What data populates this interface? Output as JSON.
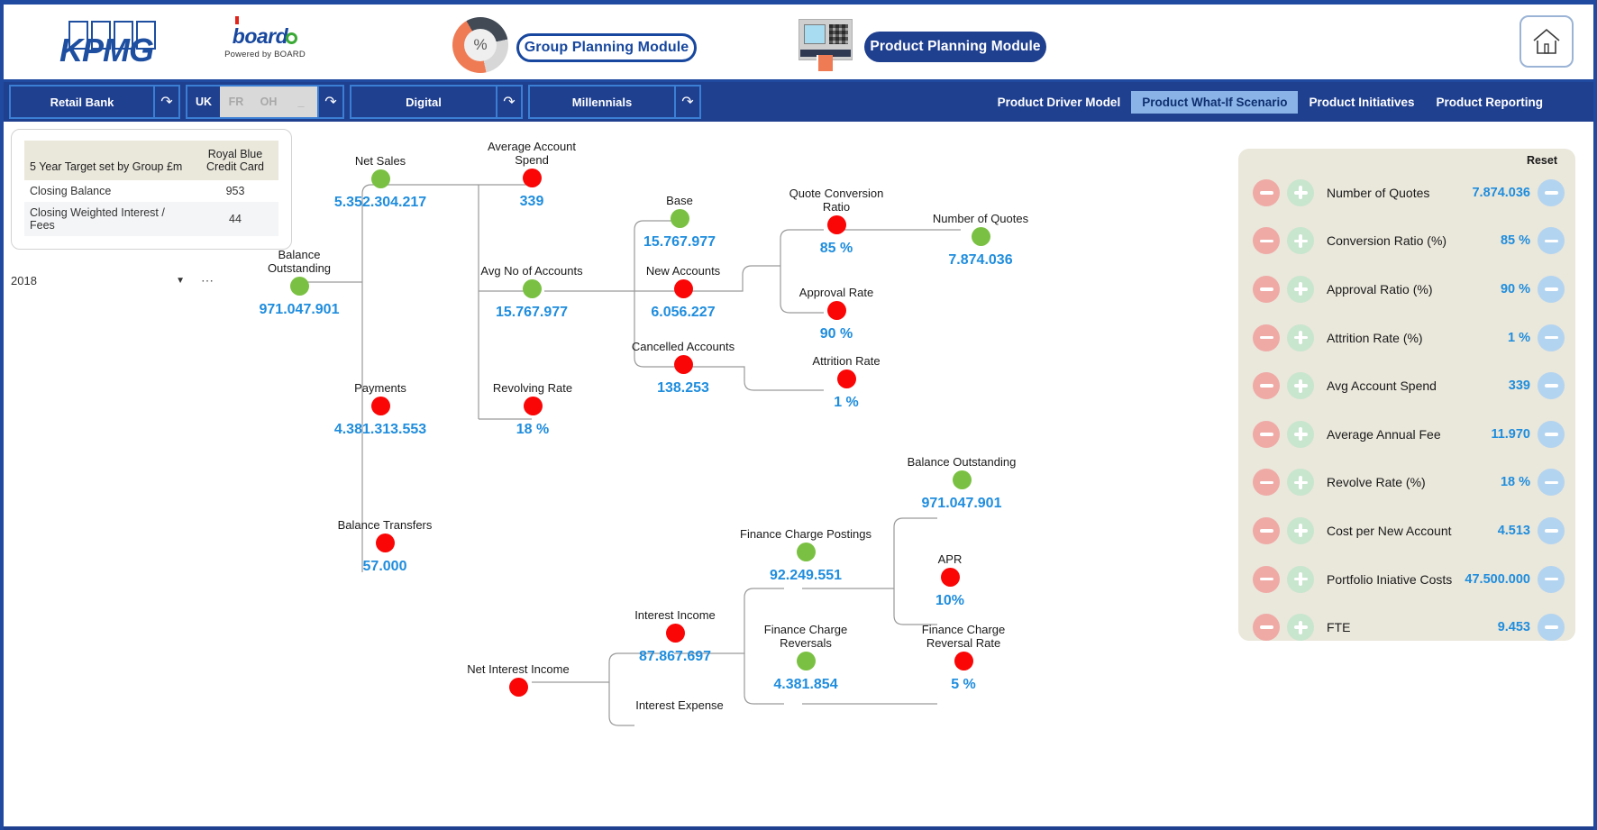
{
  "header": {
    "kpmg_logo_text": "KPMG",
    "board_logo_text": "board",
    "board_tagline": "Powered by BOARD",
    "donut_symbol": "%",
    "group_module_label": "Group Planning Module",
    "product_module_label": "Product  Planning Module",
    "home_icon": "home-icon"
  },
  "nav": {
    "entity": "Retail Bank",
    "countries": [
      "UK",
      "FR",
      "OH",
      "_"
    ],
    "channel": "Digital",
    "segment": "Millennials",
    "refresh_icon": "refresh-icon",
    "tabs": [
      {
        "label": "Product Driver Model",
        "active": false
      },
      {
        "label": "Product What-If Scenario",
        "active": true
      },
      {
        "label": "Product Initiatives",
        "active": false
      },
      {
        "label": "Product Reporting",
        "active": false
      }
    ]
  },
  "target_card": {
    "col_header_1": "5 Year Target set by Group £m",
    "col_header_2": "Royal Blue Credit Card",
    "rows": [
      {
        "label": "Closing Balance",
        "value": "953"
      },
      {
        "label": "Closing Weighted Interest / Fees",
        "value": "44"
      }
    ]
  },
  "year_selector": {
    "value": "2018",
    "caret_icon": "chevron-down-icon",
    "more_icon": "ellipsis-icon"
  },
  "chart_data": {
    "type": "diagram",
    "title": "Product What-If Scenario Driver Tree",
    "nodes": [
      {
        "id": "balance_outstanding",
        "label": "Balance Outstanding",
        "value": "971.047.901",
        "status": "green"
      },
      {
        "id": "net_sales",
        "label": "Net Sales",
        "value": "5.352.304.217",
        "status": "green"
      },
      {
        "id": "average_account_spend",
        "label": "Average Account Spend",
        "value": "339",
        "status": "red"
      },
      {
        "id": "avg_no_of_accounts",
        "label": "Avg No of Accounts",
        "value": "15.767.977",
        "status": "green"
      },
      {
        "id": "base",
        "label": "Base",
        "value": "15.767.977",
        "status": "green"
      },
      {
        "id": "new_accounts",
        "label": "New Accounts",
        "value": "6.056.227",
        "status": "red"
      },
      {
        "id": "cancelled_accounts",
        "label": "Cancelled Accounts",
        "value": "138.253",
        "status": "red"
      },
      {
        "id": "quote_conversion_ratio",
        "label": "Quote Conversion Ratio",
        "value": "85  %",
        "status": "red"
      },
      {
        "id": "approval_rate",
        "label": "Approval Rate",
        "value": "90 %",
        "status": "red"
      },
      {
        "id": "number_of_quotes",
        "label": "Number of Quotes",
        "value": "7.874.036",
        "status": "green"
      },
      {
        "id": "attrition_rate",
        "label": "Attrition Rate",
        "value": "1  %",
        "status": "red"
      },
      {
        "id": "payments",
        "label": "Payments",
        "value": "4.381.313.553",
        "status": "red"
      },
      {
        "id": "revolving_rate",
        "label": "Revolving Rate",
        "value": "18 %",
        "status": "red"
      },
      {
        "id": "balance_transfers",
        "label": "Balance Transfers",
        "value": "57.000",
        "status": "red"
      },
      {
        "id": "net_interest_income",
        "label": "Net Interest Income",
        "value": "",
        "status": "red"
      },
      {
        "id": "interest_income",
        "label": "Interest Income",
        "value": "87.867.697",
        "status": "red"
      },
      {
        "id": "interest_expense",
        "label": "Interest Expense",
        "value": "",
        "status": "none"
      },
      {
        "id": "finance_charge_postings",
        "label": "Finance Charge Postings",
        "value": "92.249.551",
        "status": "green"
      },
      {
        "id": "finance_charge_reversals",
        "label": "Finance Charge Reversals",
        "value": "4.381.854",
        "status": "green"
      },
      {
        "id": "balance_outstanding_2",
        "label": "Balance Outstanding",
        "value": "971.047.901",
        "status": "green"
      },
      {
        "id": "apr",
        "label": "APR",
        "value": "10%",
        "status": "red"
      },
      {
        "id": "fc_reversal_rate",
        "label": "Finance Charge Reversal Rate",
        "value": "5 %",
        "status": "red"
      }
    ]
  },
  "control_panel": {
    "reset_label": "Reset",
    "minus_icon": "minus-circle-icon",
    "plus_icon": "plus-circle-icon",
    "reset_icon": "reset-circle-icon",
    "rows": [
      {
        "label": "Number of Quotes",
        "value": "7.874.036"
      },
      {
        "label": "Conversion Ratio (%)",
        "value": "85 %"
      },
      {
        "label": "Approval Ratio (%)",
        "value": "90 %"
      },
      {
        "label": "Attrition Rate (%)",
        "value": "1 %"
      },
      {
        "label": "Avg Account Spend",
        "value": "339"
      },
      {
        "label": "Average Annual Fee",
        "value": "11.970"
      },
      {
        "label": "Revolve Rate (%)",
        "value": "18 %"
      },
      {
        "label": "Cost per New Account",
        "value": "4.513"
      },
      {
        "label": "Portfolio Iniative Costs",
        "value": "47.500.000"
      },
      {
        "label": "FTE",
        "value": "9.453"
      }
    ]
  },
  "colors": {
    "brand_blue": "#1f3f8f",
    "value_blue": "#1f8ddd",
    "green_node": "#7ac143",
    "red_node": "#fa0606",
    "panel_beige": "#eae7db"
  }
}
